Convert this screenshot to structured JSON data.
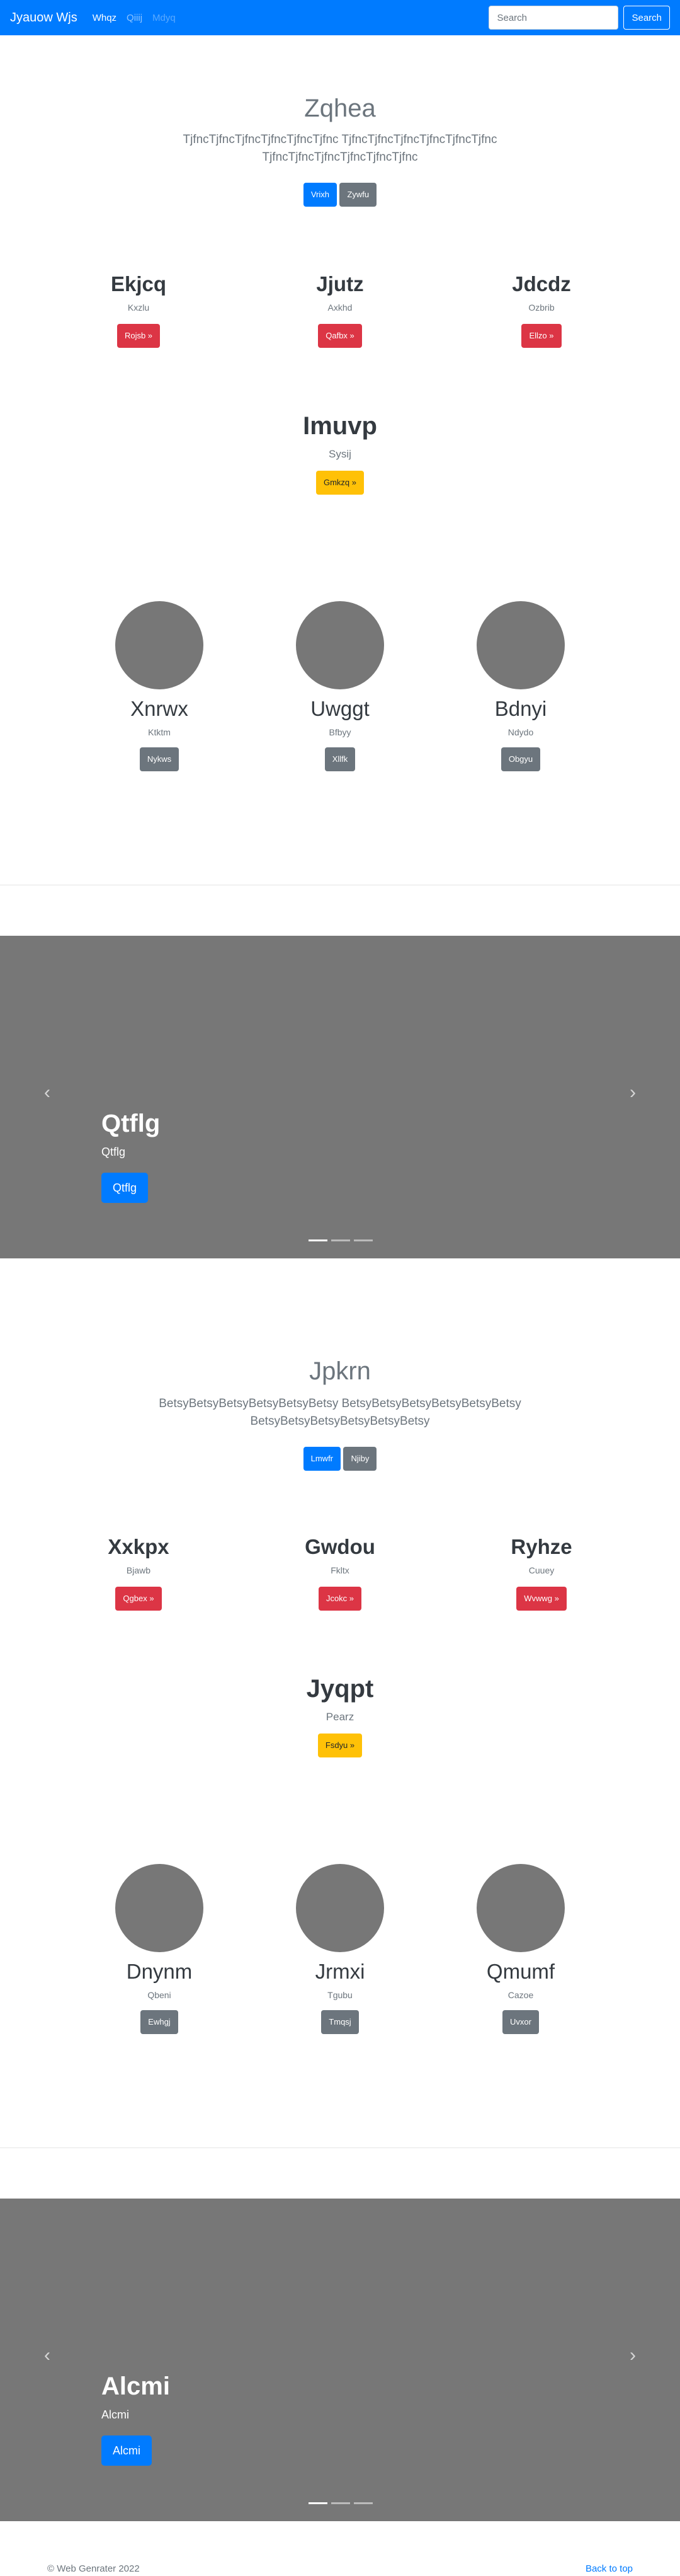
{
  "navbar": {
    "brand": "Jyauow Wjs",
    "links": [
      "Whqz",
      "Qiiij",
      "Mdyq"
    ],
    "search_placeholder": "Search",
    "search_button": "Search"
  },
  "section1": {
    "jumbo": {
      "title": "Zqhea",
      "lead": "TjfncTjfncTjfncTjfncTjfncTjfnc TjfncTjfncTjfncTjfncTjfncTjfnc TjfncTjfncTjfncTjfncTjfncTjfnc",
      "primary": "Vrixh",
      "secondary": "Zywfu"
    },
    "columns": [
      {
        "title": "Ekjcq",
        "sub": "Kxzlu",
        "button": "Rojsb »"
      },
      {
        "title": "Jjutz",
        "sub": "Axkhd",
        "button": "Qafbx »"
      },
      {
        "title": "Jdcdz",
        "sub": "Ozbrib",
        "button": "Ellzo »"
      }
    ],
    "feature": {
      "title": "Imuvp",
      "sub": "Sysij",
      "button": "Gmkzq »"
    },
    "team": [
      {
        "name": "Xnrwx",
        "sub": "Ktktm",
        "button": "Nykws"
      },
      {
        "name": "Uwggt",
        "sub": "Bfbyy",
        "button": "Xllfk"
      },
      {
        "name": "Bdnyi",
        "sub": "Ndydo",
        "button": "Obgyu"
      }
    ]
  },
  "carousel1": {
    "title": "Qtflg",
    "sub": "Qtflg",
    "button": "Qtflg",
    "prev": "‹",
    "next": "›"
  },
  "section2": {
    "jumbo": {
      "title": "Jpkrn",
      "lead": "BetsyBetsyBetsyBetsyBetsyBetsy BetsyBetsyBetsyBetsyBetsyBetsy BetsyBetsyBetsyBetsyBetsyBetsy",
      "primary": "Lmwfr",
      "secondary": "Njiby"
    },
    "columns": [
      {
        "title": "Xxkpx",
        "sub": "Bjawb",
        "button": "Qgbex »"
      },
      {
        "title": "Gwdou",
        "sub": "Fkltx",
        "button": "Jcokc »"
      },
      {
        "title": "Ryhze",
        "sub": "Cuuey",
        "button": "Wvwwg »"
      }
    ],
    "feature": {
      "title": "Jyqpt",
      "sub": "Pearz",
      "button": "Fsdyu »"
    },
    "team": [
      {
        "name": "Dnynm",
        "sub": "Qbeni",
        "button": "Ewhgj"
      },
      {
        "name": "Jrmxi",
        "sub": "Tgubu",
        "button": "Tmqsj"
      },
      {
        "name": "Qmumf",
        "sub": "Cazoe",
        "button": "Uvxor"
      }
    ]
  },
  "carousel2": {
    "title": "Alcmi",
    "sub": "Alcmi",
    "button": "Alcmi",
    "prev": "‹",
    "next": "›"
  },
  "footer": {
    "copyright": "© Web Genrater 2022",
    "back_to_top": "Back to top"
  }
}
